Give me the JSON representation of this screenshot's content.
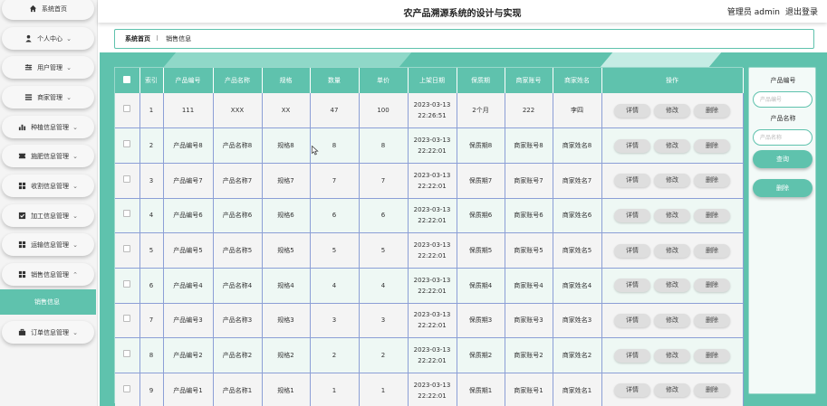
{
  "header": {
    "title": "农产品溯源系统的设计与实现",
    "user_label": "管理员 admin",
    "logout_label": "退出登录"
  },
  "sidebar": {
    "items": [
      {
        "label": "系统首页",
        "icon": "home-icon",
        "chevron": false
      },
      {
        "label": "个人中心",
        "icon": "person-icon",
        "chevron": true
      },
      {
        "label": "用户管理",
        "icon": "sliders-icon",
        "chevron": true
      },
      {
        "label": "商家管理",
        "icon": "list-icon",
        "chevron": true
      },
      {
        "label": "种植信息管理",
        "icon": "bar-chart-icon",
        "chevron": true
      },
      {
        "label": "施肥信息管理",
        "icon": "ticket-icon",
        "chevron": true
      },
      {
        "label": "收割信息管理",
        "icon": "grid-icon",
        "chevron": true
      },
      {
        "label": "加工信息管理",
        "icon": "check-square-icon",
        "chevron": true
      },
      {
        "label": "运输信息管理",
        "icon": "grid-icon",
        "chevron": true
      },
      {
        "label": "销售信息管理",
        "icon": "grid-icon",
        "chevron": true,
        "expanded": true
      },
      {
        "label": "订单信息管理",
        "icon": "briefcase-icon",
        "chevron": true
      }
    ],
    "active_sub": "销售信息"
  },
  "breadcrumb": {
    "home": "系统首页",
    "separator": "⠇",
    "current": "销售信息"
  },
  "table": {
    "columns": [
      "索引",
      "产品编号",
      "产品名称",
      "规格",
      "数量",
      "单价",
      "上架日期",
      "保质期",
      "商家账号",
      "商家姓名",
      "操作"
    ],
    "rows": [
      {
        "index": "1",
        "code": "111",
        "name": "XXX",
        "spec": "XX",
        "qty": "47",
        "price": "100",
        "date": "2023-03-13",
        "time": "22:26:51",
        "shelf": "2个月",
        "account": "222",
        "merchant": "李四"
      },
      {
        "index": "2",
        "code": "产品编号8",
        "name": "产品名称8",
        "spec": "规格8",
        "qty": "8",
        "price": "8",
        "date": "2023-03-13",
        "time": "22:22:01",
        "shelf": "保质期8",
        "account": "商家账号8",
        "merchant": "商家姓名8"
      },
      {
        "index": "3",
        "code": "产品编号7",
        "name": "产品名称7",
        "spec": "规格7",
        "qty": "7",
        "price": "7",
        "date": "2023-03-13",
        "time": "22:22:01",
        "shelf": "保质期7",
        "account": "商家账号7",
        "merchant": "商家姓名7"
      },
      {
        "index": "4",
        "code": "产品编号6",
        "name": "产品名称6",
        "spec": "规格6",
        "qty": "6",
        "price": "6",
        "date": "2023-03-13",
        "time": "22:22:01",
        "shelf": "保质期6",
        "account": "商家账号6",
        "merchant": "商家姓名6"
      },
      {
        "index": "5",
        "code": "产品编号5",
        "name": "产品名称5",
        "spec": "规格5",
        "qty": "5",
        "price": "5",
        "date": "2023-03-13",
        "time": "22:22:01",
        "shelf": "保质期5",
        "account": "商家账号5",
        "merchant": "商家姓名5"
      },
      {
        "index": "6",
        "code": "产品编号4",
        "name": "产品名称4",
        "spec": "规格4",
        "qty": "4",
        "price": "4",
        "date": "2023-03-13",
        "time": "22:22:01",
        "shelf": "保质期4",
        "account": "商家账号4",
        "merchant": "商家姓名4"
      },
      {
        "index": "7",
        "code": "产品编号3",
        "name": "产品名称3",
        "spec": "规格3",
        "qty": "3",
        "price": "3",
        "date": "2023-03-13",
        "time": "22:22:01",
        "shelf": "保质期3",
        "account": "商家账号3",
        "merchant": "商家姓名3"
      },
      {
        "index": "8",
        "code": "产品编号2",
        "name": "产品名称2",
        "spec": "规格2",
        "qty": "2",
        "price": "2",
        "date": "2023-03-13",
        "time": "22:22:01",
        "shelf": "保质期2",
        "account": "商家账号2",
        "merchant": "商家姓名2"
      },
      {
        "index": "9",
        "code": "产品编号1",
        "name": "产品名称1",
        "spec": "规格1",
        "qty": "1",
        "price": "1",
        "date": "2023-03-13",
        "time": "22:22:01",
        "shelf": "保质期1",
        "account": "商家账号1",
        "merchant": "商家姓名1"
      }
    ],
    "actions": {
      "detail": "详情",
      "edit": "修改",
      "delete": "删除"
    }
  },
  "search": {
    "code_label": "产品编号",
    "code_placeholder": "产品编号",
    "name_label": "产品名称",
    "name_placeholder": "产品名称",
    "query_label": "查询",
    "delete_label": "删除"
  },
  "colors": {
    "accent": "#5fc2ad",
    "row_border": "#8c9fd6"
  }
}
